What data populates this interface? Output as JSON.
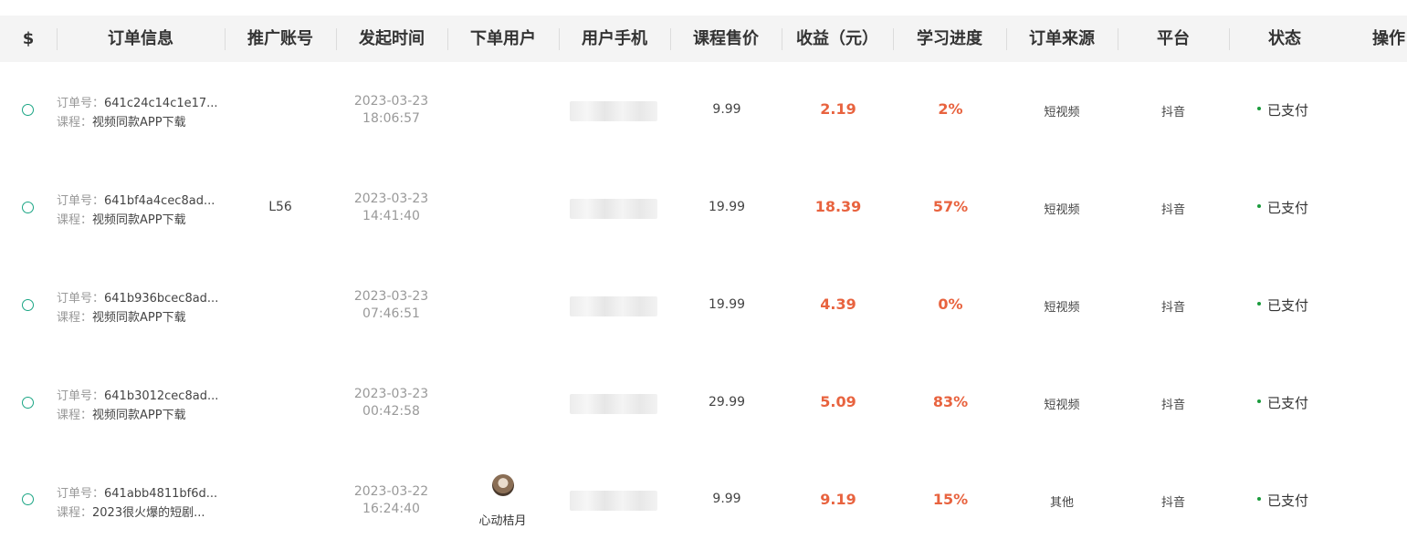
{
  "columns": [
    "$",
    "订单信息",
    "推广账号",
    "发起时间",
    "下单用户",
    "用户手机",
    "课程售价",
    "收益（元）",
    "学习进度",
    "订单来源",
    "平台",
    "状态",
    "操作"
  ],
  "labels": {
    "order_no": "订单号：",
    "course": "课程："
  },
  "rows": [
    {
      "order_no": "641c24c14c1e17...",
      "course": "视频同款APP下载",
      "promo": "",
      "date": "2023-03-23",
      "time": "18:06:57",
      "user_name": "",
      "price": "9.99",
      "income": "2.19",
      "progress": "2%",
      "source": "短视频",
      "platform": "抖音",
      "status": "已支付"
    },
    {
      "order_no": "641bf4a4cec8ad...",
      "course": "视频同款APP下载",
      "promo": "L56",
      "date": "2023-03-23",
      "time": "14:41:40",
      "user_name": "",
      "price": "19.99",
      "income": "18.39",
      "progress": "57%",
      "source": "短视频",
      "platform": "抖音",
      "status": "已支付"
    },
    {
      "order_no": "641b936bcec8ad...",
      "course": "视频同款APP下载",
      "promo": "",
      "date": "2023-03-23",
      "time": "07:46:51",
      "user_name": "",
      "price": "19.99",
      "income": "4.39",
      "progress": "0%",
      "source": "短视频",
      "platform": "抖音",
      "status": "已支付"
    },
    {
      "order_no": "641b3012cec8ad...",
      "course": "视频同款APP下载",
      "promo": "",
      "date": "2023-03-23",
      "time": "00:42:58",
      "user_name": "",
      "price": "29.99",
      "income": "5.09",
      "progress": "83%",
      "source": "短视频",
      "platform": "抖音",
      "status": "已支付"
    },
    {
      "order_no": "641abb4811bf6d...",
      "course": "2023很火爆的短剧...",
      "promo": "",
      "date": "2023-03-22",
      "time": "16:24:40",
      "user_name": "心动桔月",
      "has_avatar": true,
      "price": "9.99",
      "income": "9.19",
      "progress": "15%",
      "source": "其他",
      "platform": "抖音",
      "status": "已支付"
    }
  ],
  "colors": {
    "accent": "#1aa584",
    "income": "#e8633f",
    "status_dot": "#1a9b3c",
    "header_bg": "#f4f4f4"
  }
}
